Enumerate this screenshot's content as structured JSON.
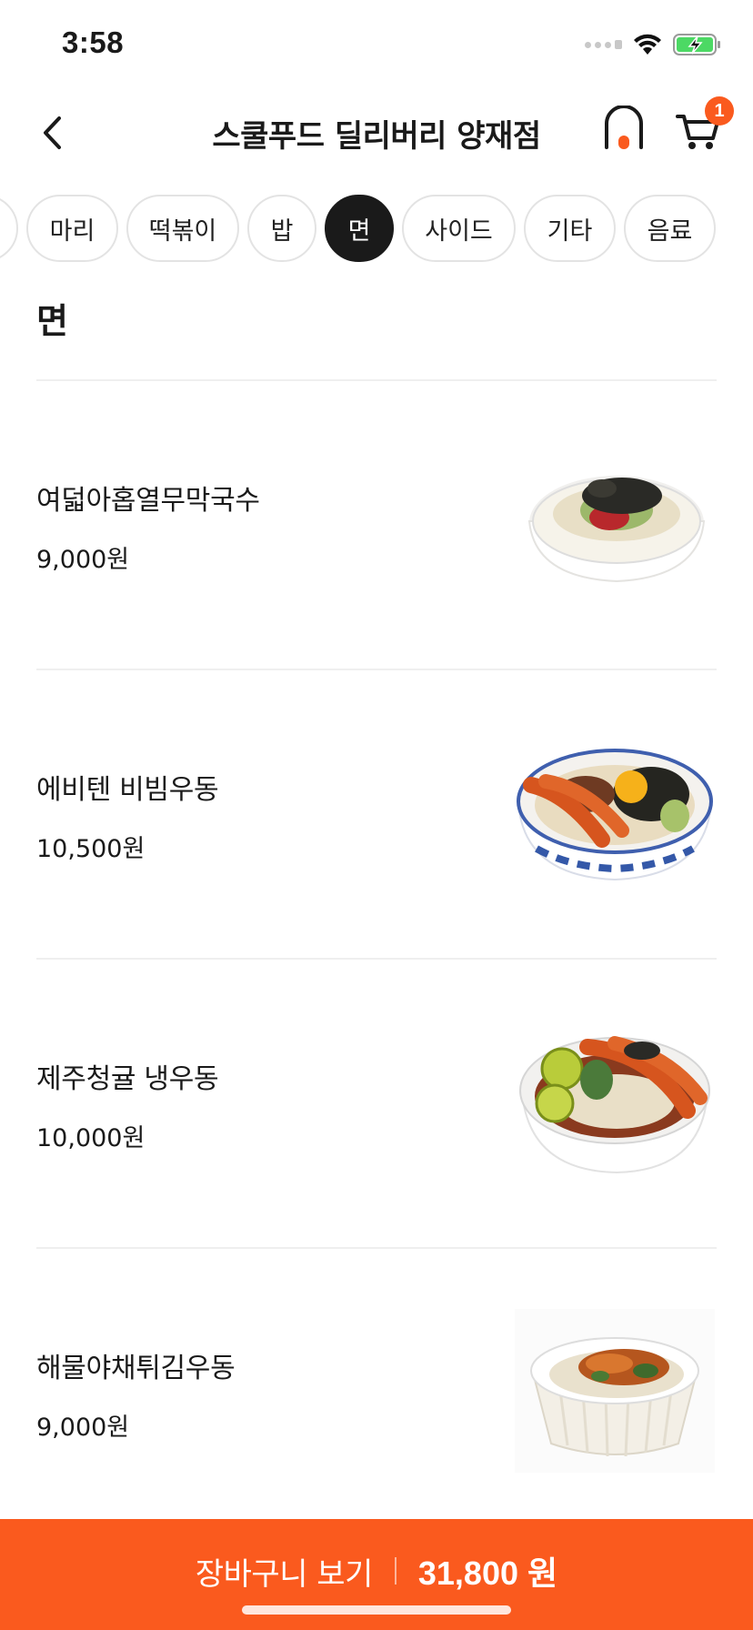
{
  "status_bar": {
    "time": "3:58",
    "icons": [
      "signal-icon",
      "wifi-icon",
      "battery-charging-icon"
    ]
  },
  "header": {
    "title": "스쿨푸드 딜리버리 양재점",
    "cart_count": "1"
  },
  "categories": [
    {
      "label": "",
      "active": false
    },
    {
      "label": "마리",
      "active": false
    },
    {
      "label": "떡볶이",
      "active": false
    },
    {
      "label": "밥",
      "active": false
    },
    {
      "label": "면",
      "active": true
    },
    {
      "label": "사이드",
      "active": false
    },
    {
      "label": "기타",
      "active": false
    },
    {
      "label": "음료",
      "active": false
    }
  ],
  "section": {
    "title": "면"
  },
  "menu_items": [
    {
      "name": "여덟아홉열무막국수",
      "price": "9,000원",
      "image": "noodle-bowl-seaweed-image"
    },
    {
      "name": "에비텐 비빔우동",
      "price": "10,500원",
      "image": "shrimp-tempura-udon-image"
    },
    {
      "name": "제주청귤 냉우동",
      "price": "10,000원",
      "image": "citrus-cold-udon-image"
    },
    {
      "name": "해물야채튀김우동",
      "price": "9,000원",
      "image": "seafood-vegetable-udon-image"
    }
  ],
  "cart_bar": {
    "label": "장바구니 보기",
    "total": "31,800 원"
  },
  "colors": {
    "accent": "#fa5a1e",
    "chip_active": "#1a1a1a",
    "divider": "#efefef"
  }
}
